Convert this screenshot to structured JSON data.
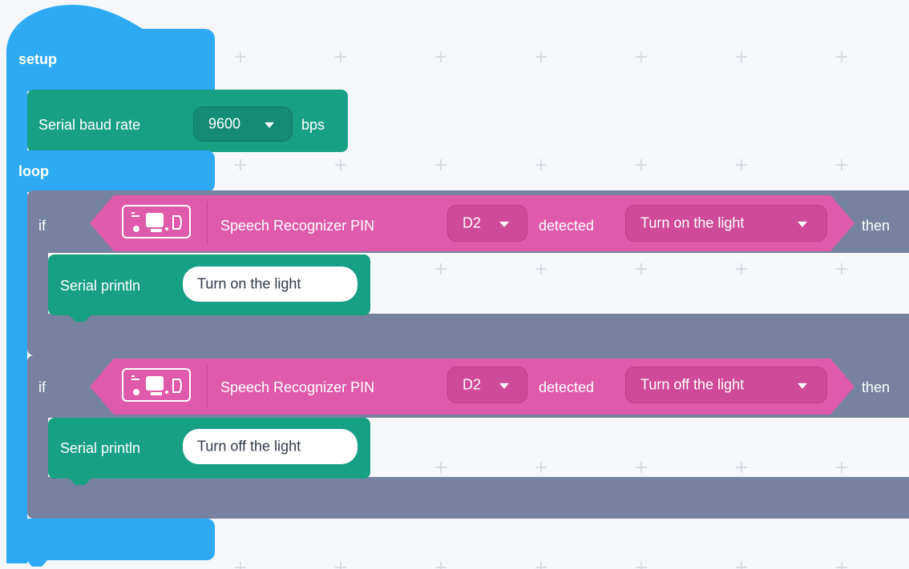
{
  "setup_block": {
    "label": "setup"
  },
  "serial_baud": {
    "label": "Serial baud rate",
    "value": "9600",
    "unit": "bps"
  },
  "loop_block": {
    "label": "loop"
  },
  "if_blocks": [
    {
      "if_label": "if",
      "condition": {
        "icon": "speech-recognizer-module-icon",
        "label": "Speech Recognizer PIN",
        "pin": "D2",
        "detected_label": "detected",
        "command": "Turn on the light"
      },
      "then_label": "then",
      "action": {
        "label": "Serial println",
        "text": "Turn on the light"
      }
    },
    {
      "if_label": "if",
      "condition": {
        "icon": "speech-recognizer-module-icon",
        "label": "Speech Recognizer PIN",
        "pin": "D2",
        "detected_label": "detected",
        "command": "Turn off the light"
      },
      "then_label": "then",
      "action": {
        "label": "Serial println",
        "text": "Turn off the light"
      }
    }
  ],
  "colors": {
    "workspace": "#f5f7fa",
    "event_blue": "#2eaaf5",
    "serial_teal": "#18a085",
    "control_gray": "#7682a0",
    "sensor_pink": "#e05aac"
  }
}
